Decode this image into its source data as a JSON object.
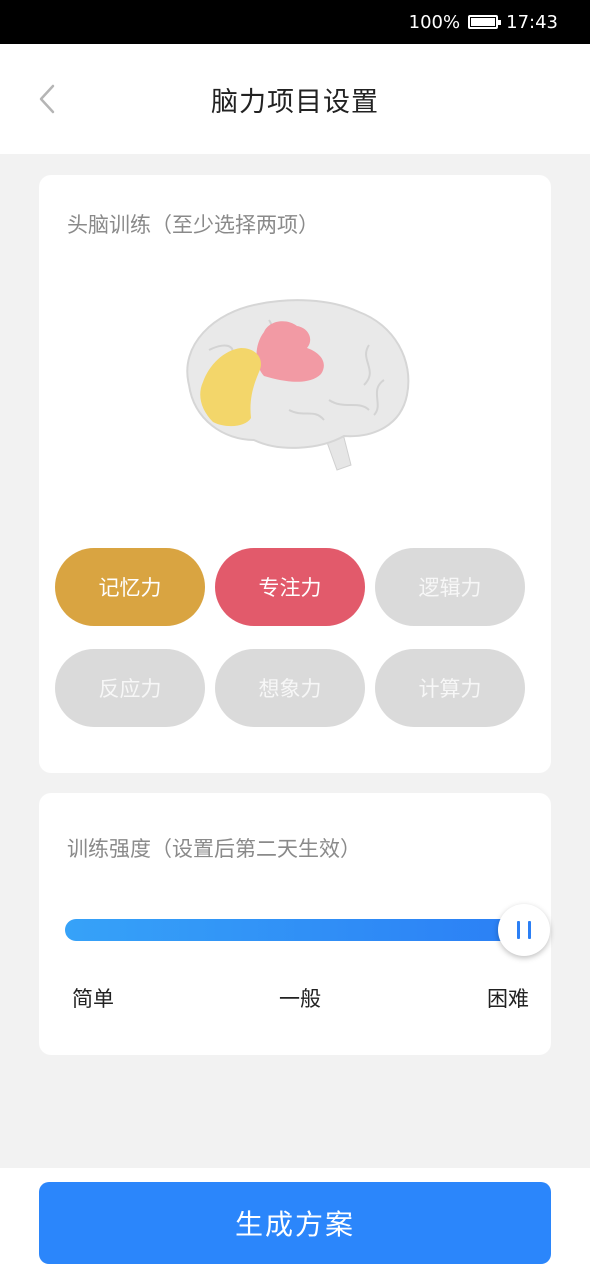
{
  "status_bar": {
    "battery_text": "100%",
    "time": "17:43"
  },
  "nav": {
    "title": "脑力项目设置"
  },
  "brain_training": {
    "label": "头脑训练（至少选择两项）",
    "skills": [
      {
        "label": "记忆力",
        "selected": true,
        "color": "#d9a441"
      },
      {
        "label": "专注力",
        "selected": true,
        "color": "#e25a6b"
      },
      {
        "label": "逻辑力",
        "selected": false
      },
      {
        "label": "反应力",
        "selected": false
      },
      {
        "label": "想象力",
        "selected": false
      },
      {
        "label": "计算力",
        "selected": false
      }
    ]
  },
  "intensity": {
    "label": "训练强度（设置后第二天生效）",
    "levels": [
      "简单",
      "一般",
      "困难"
    ],
    "selected_level": "困难",
    "value_fraction": 1.0
  },
  "footer": {
    "button_label": "生成方案"
  },
  "colors": {
    "accent": "#2b86fb",
    "memory": "#d9a441",
    "focus": "#e25a6b",
    "inactive": "#dadada"
  }
}
